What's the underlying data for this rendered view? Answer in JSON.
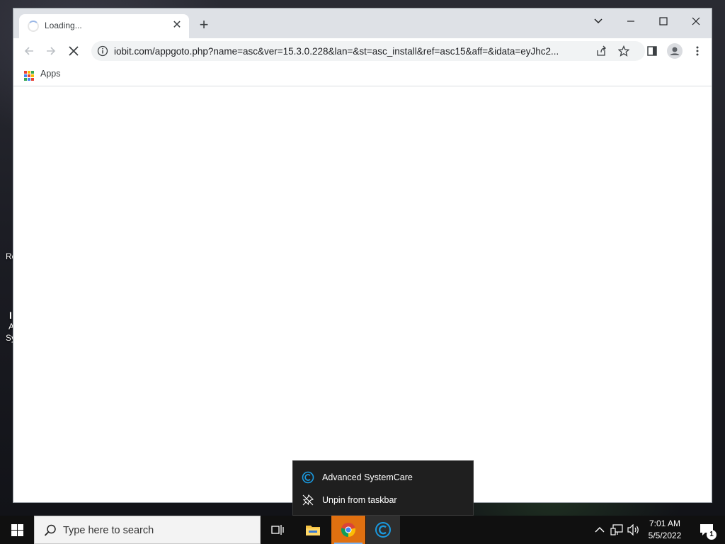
{
  "desktop": {
    "icon_fragments": [
      "Re",
      "I",
      "A",
      "Sy"
    ]
  },
  "browser": {
    "tab": {
      "title": "Loading...",
      "close_glyph": "✕"
    },
    "new_tab_glyph": "+",
    "window_controls": {
      "tabsearch": "⌄",
      "minimize": "—",
      "maximize": "☐",
      "close": "✕"
    },
    "url": "iobit.com/appgoto.php?name=asc&ver=15.3.0.228&lan=&st=asc_install&ref=asc15&aff=&idata=eyJhc2...",
    "bookmarks": {
      "apps_label": "Apps"
    },
    "apps_colors": [
      "#ea4335",
      "#fbbc04",
      "#34a853",
      "#4285f4",
      "#ea4335",
      "#fbbc04",
      "#34a853",
      "#4285f4",
      "#ea4335"
    ]
  },
  "jumplist": {
    "items": [
      {
        "label": "Advanced SystemCare",
        "icon": "advanced-systemcare-icon"
      },
      {
        "label": "Unpin from taskbar",
        "icon": "unpin-icon"
      }
    ]
  },
  "taskbar": {
    "search_placeholder": "Type here to search",
    "pinned": [
      "task-view-icon",
      "file-explorer-icon",
      "chrome-icon",
      "advanced-systemcare-icon"
    ],
    "clock": {
      "time": "7:01 AM",
      "date": "5/5/2022"
    },
    "notification_count": "1"
  },
  "colors": {
    "accent_orange": "#e07010",
    "asc_blue": "#1a9ae0"
  }
}
